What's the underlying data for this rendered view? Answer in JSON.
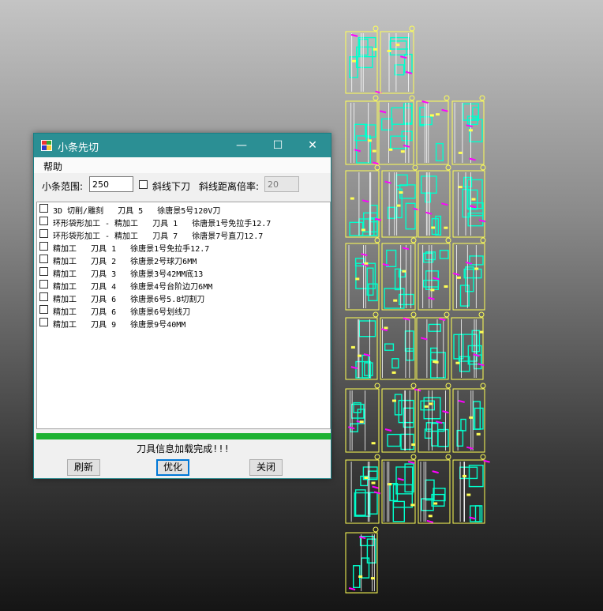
{
  "window": {
    "title": "小条先切",
    "minimize_glyph": "—",
    "maximize_glyph": "☐",
    "close_glyph": "✕"
  },
  "menu": {
    "help": "帮助"
  },
  "toolbar": {
    "range_label": "小条范围:",
    "range_value": "250",
    "diagonal_label": "斜线下刀",
    "diagonal_checked": false,
    "ratio_label": "斜线距离倍率:",
    "ratio_value": "20"
  },
  "tools": [
    {
      "text": "3D 切削/雕刻   刀具 5   徐唐景5号120V刀",
      "checked": false
    },
    {
      "text": "环形袋形加工 - 精加工   刀具 1   徐唐景1号免拉手12.7",
      "checked": false
    },
    {
      "text": "环形袋形加工 - 精加工   刀具 7   徐唐景7号直刀12.7",
      "checked": false
    },
    {
      "text": "精加工   刀具 1   徐唐景1号免拉手12.7",
      "checked": false
    },
    {
      "text": "精加工   刀具 2   徐唐景2号球刀6MM",
      "checked": false
    },
    {
      "text": "精加工   刀具 3   徐唐景3号42MM底13",
      "checked": false
    },
    {
      "text": "精加工   刀具 4   徐唐景4号台阶边刀6MM",
      "checked": false
    },
    {
      "text": "精加工   刀具 6   徐唐景6号5.8切割刀",
      "checked": false
    },
    {
      "text": "精加工   刀具 6   徐唐景6号划线刀",
      "checked": false
    },
    {
      "text": "精加工   刀具 9   徐唐景9号40MM",
      "checked": false
    }
  ],
  "progress": 1.0,
  "status": "刀具信息加载完成!!!",
  "buttons": {
    "refresh": "刷新",
    "optimize": "优化",
    "close": "关闭"
  },
  "colors": {
    "titlebar": "#2b8f94",
    "progress": "#1db233",
    "cad_yellow": "#ffff55",
    "cad_cyan": "#00ffcc",
    "cad_magenta": "#ff00ff",
    "cad_white": "#ffffff"
  }
}
